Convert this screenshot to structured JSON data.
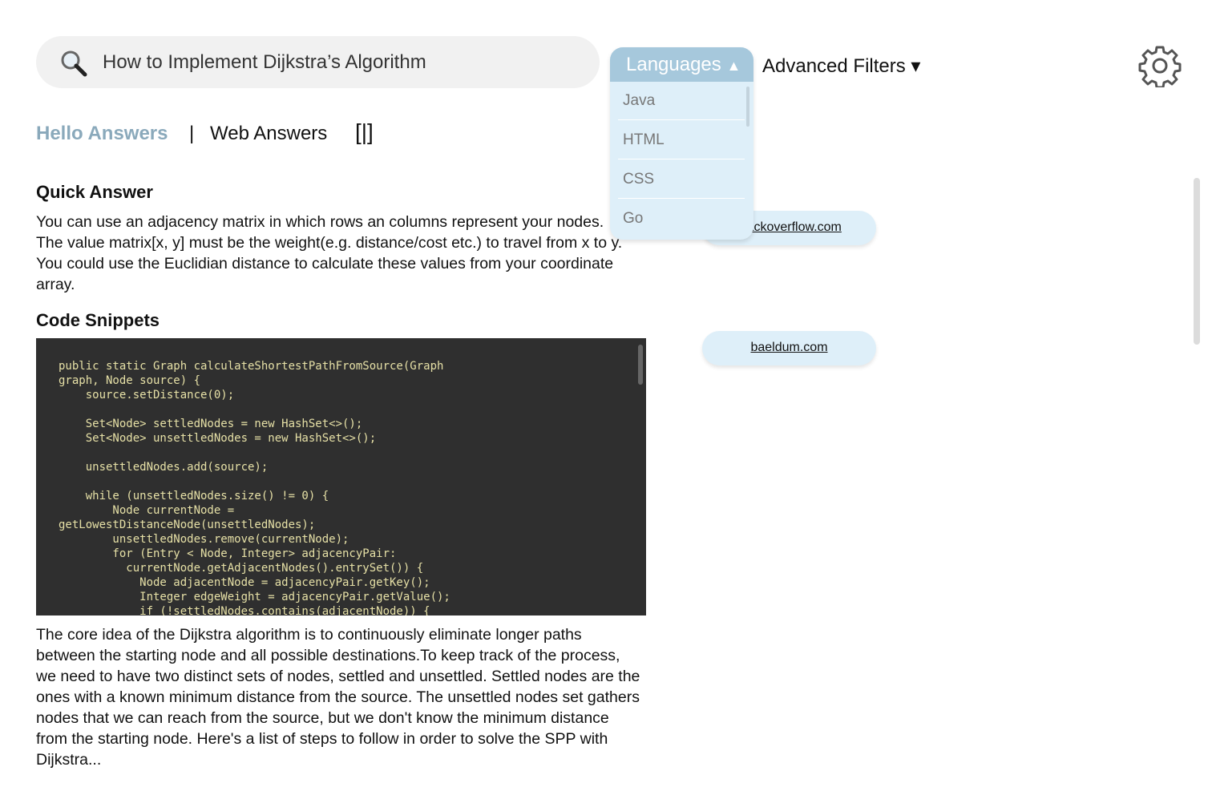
{
  "search": {
    "query": "How to Implement Dijkstra’s Algorithm",
    "icon": "magnifier-icon"
  },
  "languages": {
    "label": "Languages",
    "arrow": "▲",
    "options": [
      "Java",
      "HTML",
      "CSS",
      "Go"
    ]
  },
  "advanced_filters": {
    "label": "Advanced Filters",
    "arrow": "▾"
  },
  "settings": {
    "icon": "gear-icon"
  },
  "tabs": {
    "hello": "Hello Answers",
    "divider": "|",
    "web": "Web Answers",
    "toggle": "[|]"
  },
  "colors": {
    "accent": "#a6c8dc",
    "pill": "#deeff9",
    "active_tab": "#8aa9bb",
    "code_bg": "#2f2f2f",
    "code_text": "#e6e0a6"
  },
  "quick_answer": {
    "title": "Quick Answer",
    "text": "You can use an adjacency matrix in which rows an columns represent your nodes. The value matrix[x, y] must be the weight(e.g. distance/cost etc.) to travel from x to y. You could use the Euclidian distance to calculate these values from your coordinate array."
  },
  "code_snippets": {
    "title": "Code Snippets",
    "code": "public static Graph calculateShortestPathFromSource(Graph\ngraph, Node source) {\n    source.setDistance(0);\n\n    Set<Node> settledNodes = new HashSet<>();\n    Set<Node> unsettledNodes = new HashSet<>();\n\n    unsettledNodes.add(source);\n\n    while (unsettledNodes.size() != 0) {\n        Node currentNode =\ngetLowestDistanceNode(unsettledNodes);\n        unsettledNodes.remove(currentNode);\n        for (Entry < Node, Integer> adjacencyPair:\n          currentNode.getAdjacentNodes().entrySet()) {\n            Node adjacentNode = adjacencyPair.getKey();\n            Integer edgeWeight = adjacencyPair.getValue();\n            if (!settledNodes.contains(adjacentNode)) {"
  },
  "description": "The core idea of the Dijkstra algorithm is to continuously eliminate longer paths between the starting node and all possible destinations.To keep track of the process, we need to have two distinct sets of nodes, settled and unsettled. Settled nodes are the ones with a known minimum distance from the source. The unsettled nodes set gathers nodes that we can reach from the source, but we don't know the minimum distance from the starting node. Here's a list of steps to follow in order to solve the SPP with Dijkstra...",
  "sources": [
    "stackoverflow.com",
    "baeldum.com"
  ]
}
